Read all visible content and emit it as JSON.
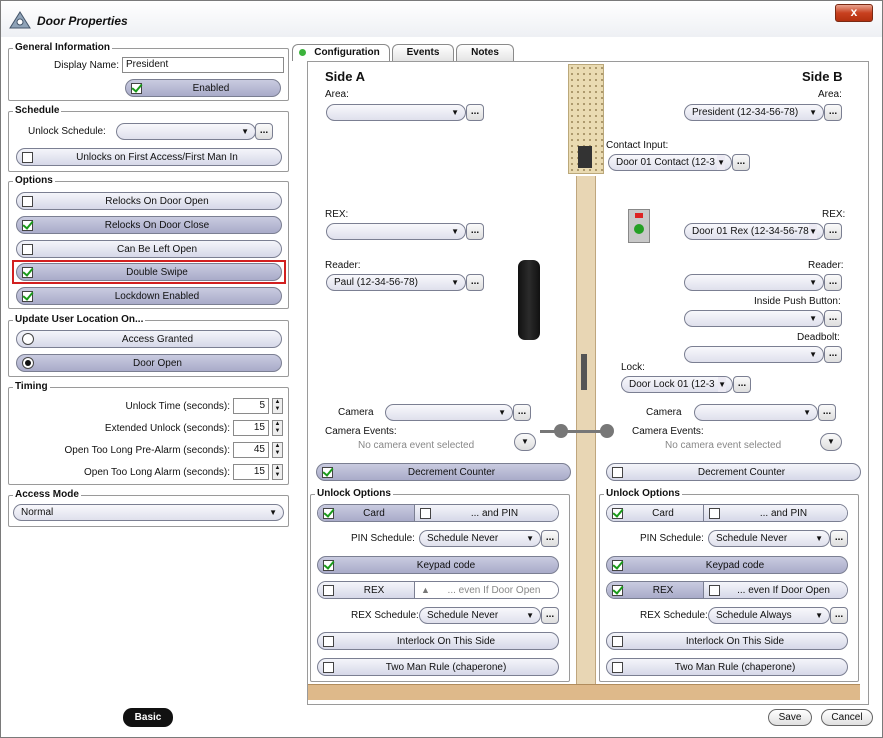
{
  "window": {
    "title": "Door Properties",
    "close_label": "x"
  },
  "general": {
    "title": "General Information",
    "display_name_label": "Display Name:",
    "display_name_value": "President",
    "enabled_label": "Enabled"
  },
  "schedule": {
    "title": "Schedule",
    "unlock_schedule_label": "Unlock Schedule:",
    "unlock_schedule_value": "",
    "first_access_label": "Unlocks on First Access/First Man In"
  },
  "options": {
    "title": "Options",
    "items": [
      {
        "label": "Relocks On Door Open",
        "checked": false
      },
      {
        "label": "Relocks On Door Close",
        "checked": true
      },
      {
        "label": "Can Be Left Open",
        "checked": false
      },
      {
        "label": "Double Swipe",
        "checked": true
      },
      {
        "label": "Lockdown Enabled",
        "checked": true
      }
    ]
  },
  "update_location": {
    "title": "Update User Location On...",
    "access_granted_label": "Access Granted",
    "door_open_label": "Door Open"
  },
  "timing": {
    "title": "Timing",
    "rows": [
      {
        "label": "Unlock Time (seconds):",
        "value": "5"
      },
      {
        "label": "Extended Unlock (seconds):",
        "value": "15"
      },
      {
        "label": "Open Too Long Pre-Alarm (seconds):",
        "value": "45"
      },
      {
        "label": "Open Too Long Alarm (seconds):",
        "value": "15"
      }
    ]
  },
  "access_mode": {
    "title": "Access Mode",
    "value": "Normal"
  },
  "tabs": [
    "Configuration",
    "Events",
    "Notes"
  ],
  "side_a": {
    "title": "Side A",
    "area_label": "Area:",
    "area_value": "",
    "rex_label": "REX:",
    "rex_value": "",
    "reader_label": "Reader:",
    "reader_value": "Paul (12-34-56-78)",
    "camera_label": "Camera",
    "camera_value": "",
    "camera_events_label": "Camera Events:",
    "camera_events_value": "No camera event selected",
    "decrement_label": "Decrement Counter",
    "unlock_title": "Unlock Options",
    "card_label": "Card",
    "and_pin_label": "... and PIN",
    "pin_schedule_label": "PIN Schedule:",
    "pin_schedule_value": "Schedule Never",
    "keypad_label": "Keypad code",
    "rex_opt_label": "REX",
    "even_if_label": "... even If Door Open",
    "rex_schedule_label": "REX Schedule:",
    "rex_schedule_value": "Schedule Never",
    "interlock_label": "Interlock On This Side",
    "two_man_label": "Two Man Rule (chaperone)"
  },
  "side_b": {
    "title": "Side B",
    "area_label": "Area:",
    "area_value": "President (12-34-56-78)",
    "contact_label": "Contact Input:",
    "contact_value": "Door 01 Contact (12-3",
    "rex_label": "REX:",
    "rex_value": "Door 01 Rex (12-34-56-78",
    "reader_label": "Reader:",
    "reader_value": "",
    "push_label": "Inside Push Button:",
    "push_value": "",
    "deadbolt_label": "Deadbolt:",
    "deadbolt_value": "",
    "lock_label": "Lock:",
    "lock_value": "Door Lock 01  (12-3",
    "camera_label": "Camera",
    "camera_value": "",
    "camera_events_label": "Camera Events:",
    "camera_events_value": "No camera event selected",
    "decrement_label": "Decrement Counter",
    "unlock_title": "Unlock Options",
    "card_label": "Card",
    "and_pin_label": "... and PIN",
    "pin_schedule_label": "PIN Schedule:",
    "pin_schedule_value": "Schedule Never",
    "keypad_label": "Keypad code",
    "rex_opt_label": "REX",
    "even_if_label": "... even If Door Open",
    "rex_schedule_label": "REX Schedule:",
    "rex_schedule_value": "Schedule Always",
    "interlock_label": "Interlock On This Side",
    "two_man_label": "Two Man Rule (chaperone)"
  },
  "footer": {
    "basic_label": "Basic",
    "save_label": "Save",
    "cancel_label": "Cancel"
  },
  "colors": {
    "highlight": "#d22020",
    "pill_on": "#b4b6d2",
    "floor": "#deb98a",
    "door": "#e8d6b4"
  }
}
